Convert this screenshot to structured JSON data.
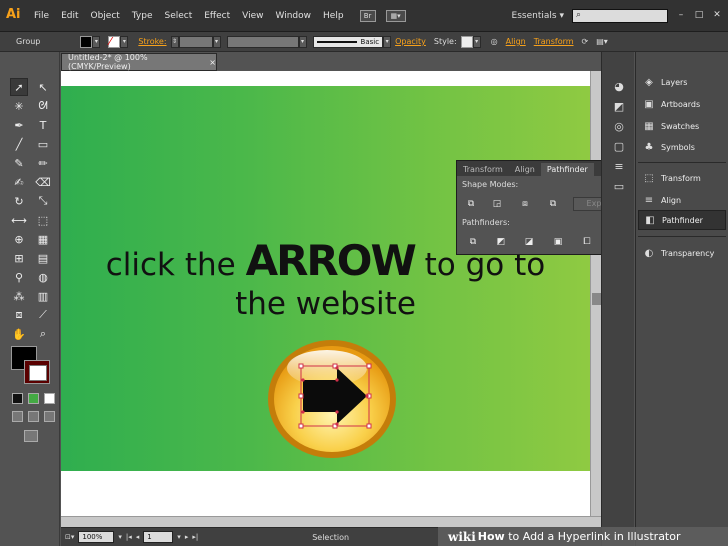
{
  "app": {
    "logo": "Ai",
    "menu": [
      "File",
      "Edit",
      "Object",
      "Type",
      "Select",
      "Effect",
      "View",
      "Window",
      "Help"
    ],
    "bridge_label": "Br",
    "workspace": "Essentials",
    "workspace_arrow": "▾",
    "search_icon": "search-icon",
    "window_controls": [
      "–",
      "□",
      "✕"
    ]
  },
  "control_bar": {
    "selection_type": "Group",
    "stroke_label": "Stroke:",
    "brush_name": "Basic",
    "opacity_label": "Opacity",
    "style_label": "Style:",
    "align_label": "Align",
    "transform_label": "Transform",
    "fill_color": "#000000",
    "stroke_color": "#ffffff"
  },
  "document": {
    "tab_title": "Untitled-2* @ 100% (CMYK/Preview)",
    "close": "×"
  },
  "canvas": {
    "line1_before": "click the",
    "line1_bold": "ARROW",
    "line1_after": "to go to",
    "line2": "the website",
    "gradient_start": "#2fae4f",
    "gradient_end": "#8fca42",
    "text_color": "#111111"
  },
  "pathfinder_panel": {
    "tabs": [
      "Transform",
      "Align",
      "Pathfinder"
    ],
    "active_tab": "Pathfinder",
    "menu_glyph": "▸▸",
    "shape_modes_label": "Shape Modes:",
    "pathfinders_label": "Pathfinders:",
    "expand_label": "Expand"
  },
  "dock": {
    "items": [
      {
        "label": "Layers",
        "icon": "layers-icon",
        "glyph": "◈"
      },
      {
        "label": "Artboards",
        "icon": "artboards-icon",
        "glyph": "▣"
      },
      {
        "label": "Swatches",
        "icon": "swatches-icon",
        "glyph": "▦"
      },
      {
        "label": "Symbols",
        "icon": "symbols-icon",
        "glyph": "♣"
      },
      {
        "label": "Transform",
        "icon": "transform-icon",
        "glyph": "⬚"
      },
      {
        "label": "Align",
        "icon": "align-icon",
        "glyph": "≡"
      },
      {
        "label": "Pathfinder",
        "icon": "pathfinder-icon",
        "glyph": "◧"
      },
      {
        "label": "Transparency",
        "icon": "transparency-icon",
        "glyph": "◐"
      }
    ]
  },
  "status_bar": {
    "zoom": "100%",
    "page": "1",
    "mode": "Selection",
    "nav_first": "|◂",
    "nav_prev": "◂",
    "nav_next": "▸",
    "nav_last": "▸|"
  },
  "watermark": {
    "wiki": "wiki",
    "how": "How",
    "text": "to Add a Hyperlink in Illustrator"
  }
}
